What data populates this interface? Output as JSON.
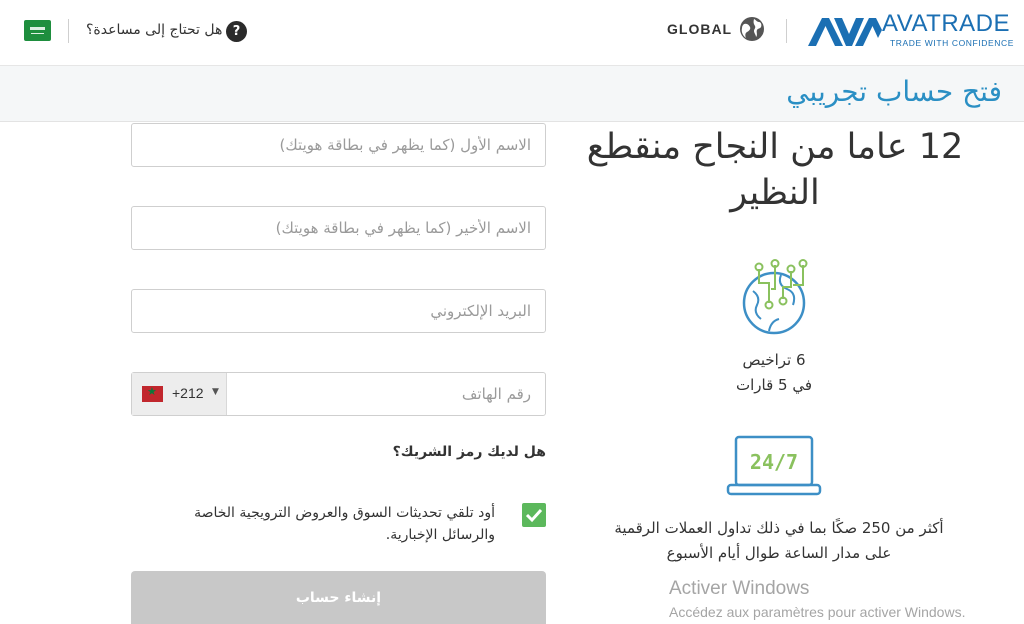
{
  "header": {
    "help_text": "هل تحتاج إلى مساعدة؟",
    "help_icon_label": "?",
    "region": "GLOBAL",
    "logo_name": "AVATRADE",
    "logo_tagline": "TRADE WITH CONFIDENCE",
    "brand_color": "#1b6fb3"
  },
  "page": {
    "title": "فتح حساب تجريبي",
    "title_color": "#2a8fc4"
  },
  "form": {
    "first_name_placeholder": "الاسم الأول (كما يظهر في بطاقة هويتك)",
    "last_name_placeholder": "الاسم الأخير (كما يظهر في بطاقة هويتك)",
    "email_placeholder": "البريد الإلكتروني",
    "phone_placeholder": "رقم الهاتف",
    "dial_code": "+212",
    "partner_code_label": "هل لديك رمز الشريك؟",
    "consent_checked": true,
    "consent_text": "أود تلقي تحديثات السوق والعروض الترويجية الخاصة والرسائل الإخبارية.",
    "submit_label": "إنشاء حساب",
    "checkbox_color": "#5cb85c"
  },
  "promo": {
    "headline": "12 عاما من النجاح منقطع النظير",
    "features": [
      {
        "icon": "digital-globe-icon",
        "line1": "6 تراخيص",
        "line2": "في 5 قارات"
      },
      {
        "icon": "laptop-24-7-icon",
        "screen_text": "24/7",
        "line1": "أكثر من 250 صكًا بما في ذلك تداول العملات الرقمية",
        "line2": "على مدار الساعة طوال أيام الأسبوع"
      }
    ]
  },
  "watermark": {
    "title": "Activer Windows",
    "subtitle": "Accédez aux paramètres pour activer Windows."
  }
}
